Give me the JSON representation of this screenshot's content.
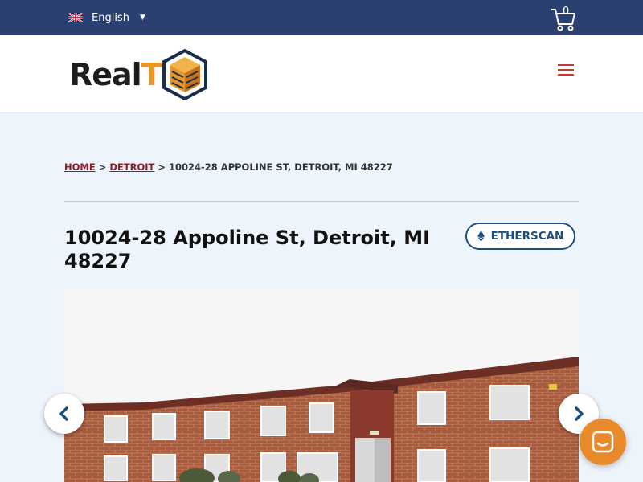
{
  "topbar": {
    "language": "English",
    "cart_count": "0"
  },
  "header": {
    "logo_text_a": "Real",
    "logo_text_b": "T"
  },
  "breadcrumb": {
    "home": "HOME",
    "city": "DETROIT",
    "separator": ">",
    "current": "10024-28 APPOLINE ST, DETROIT, MI 48227"
  },
  "property": {
    "title": "10024-28 Appoline St, Detroit, MI 48227",
    "etherscan_label": "ETHERSCAN"
  },
  "icons": {
    "language_flag": "uk-flag-icon",
    "language_caret": "caret-down-icon",
    "cart": "cart-icon",
    "menu": "hamburger-menu-icon",
    "etherscan": "ethereum-icon",
    "prev": "chevron-left-icon",
    "next": "chevron-right-icon",
    "chat": "chat-icon"
  },
  "colors": {
    "topbar": "#2a4071",
    "page_bg": "#eef4fb",
    "link": "#8f1c28",
    "etherscan": "#1d4f80",
    "chat": "#e8892a",
    "menu": "#c33a2f"
  }
}
